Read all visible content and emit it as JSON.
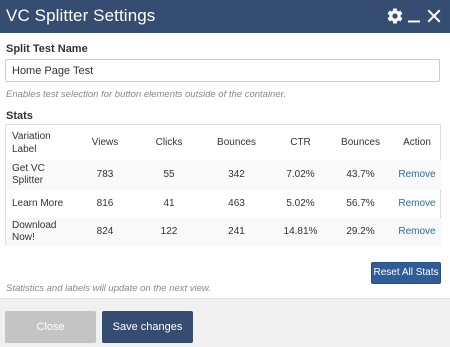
{
  "window": {
    "title": "VC Splitter Settings",
    "icons": [
      "gear-icon",
      "minimize-icon",
      "close-icon"
    ],
    "header_color": "#364d72"
  },
  "split_test": {
    "label": "Split Test Name",
    "value": "Home Page Test",
    "help": "Enables test selection for button elements outside of the container."
  },
  "stats": {
    "label": "Stats",
    "headers": {
      "variation": "Variation Label",
      "views": "Views",
      "clicks": "Clicks",
      "bounces": "Bounces",
      "ctr": "CTR",
      "bounce_rate": "Bounces",
      "action": "Action"
    },
    "rows": [
      {
        "label": "Get VC Splitter",
        "views": "783",
        "clicks": "55",
        "bounces": "342",
        "ctr": "7.02%",
        "bounce_rate": "43.7%",
        "action": "Remove"
      },
      {
        "label": "Learn More",
        "views": "816",
        "clicks": "41",
        "bounces": "463",
        "ctr": "5.02%",
        "bounce_rate": "56.7%",
        "action": "Remove"
      },
      {
        "label": "Download Now!",
        "views": "824",
        "clicks": "122",
        "bounces": "241",
        "ctr": "14.81%",
        "bounce_rate": "29.2%",
        "action": "Remove"
      }
    ],
    "reset_label": "Reset All Stats",
    "note": "Statistics and labels will update on the next view."
  },
  "footer": {
    "close_label": "Close",
    "save_label": "Save changes"
  },
  "colors": {
    "primary": "#364d72",
    "link": "#2b6b9a",
    "button": "#2f5d9a",
    "disabled": "#c4c4c4"
  }
}
